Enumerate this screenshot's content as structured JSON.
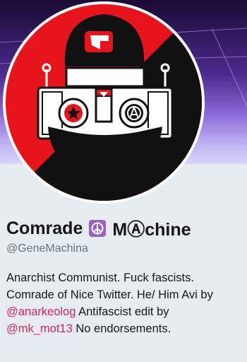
{
  "profile": {
    "name_part1": "Comrade",
    "name_part2": "MⒶchine",
    "name_emoji": "peace-symbol",
    "handle": "@GeneMachina"
  },
  "bio": {
    "line1": "Anarchist Communist. Fuck fascists.",
    "line2": "Comrade of Nice Twitter. He/ Him Avi by",
    "mention1": "@anarkeolog",
    "line3_rest": " Antifascist edit by",
    "mention2": "@mk_mot13",
    "line4_rest": " No endorsements."
  },
  "colors": {
    "page_bg": "#e6ecf0",
    "mention": "#e0245e",
    "name_text": "#14171a",
    "handle_text": "#657786",
    "avatar_red": "#e8141c",
    "avatar_black": "#111111",
    "emoji_bg": "#9b5fc0"
  }
}
